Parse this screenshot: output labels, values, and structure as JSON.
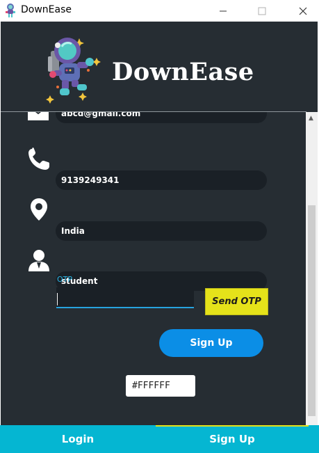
{
  "window": {
    "title": "DownEase",
    "icons": {
      "app": "astronaut-icon",
      "minimize": "minimize-icon",
      "maximize": "maximize-icon",
      "close": "close-icon"
    }
  },
  "header": {
    "logo_text": "DownEase",
    "logo_icon": "astronaut-icon"
  },
  "form": {
    "email": {
      "value": "abcd@gmail.com",
      "icon": "mail-icon"
    },
    "phone": {
      "value": "9139249341",
      "icon": "phone-icon"
    },
    "country": {
      "value": "India",
      "icon": "location-pin-icon"
    },
    "role": {
      "value": "student",
      "icon": "user-icon"
    },
    "otp_label": "OTP",
    "otp_value": "",
    "send_otp_label": "Send OTP",
    "signup_label": "Sign Up",
    "color_value": "#FFFFFF"
  },
  "tabs": [
    {
      "label": "Login"
    },
    {
      "label": "Sign Up"
    }
  ],
  "colors": {
    "background": "#262d33",
    "field": "#1a2026",
    "accent_blue": "#0b8ee6",
    "accent_yellow": "#e5e21a",
    "tabbar": "#05b6d2",
    "otp_label": "#2ab4e4"
  }
}
